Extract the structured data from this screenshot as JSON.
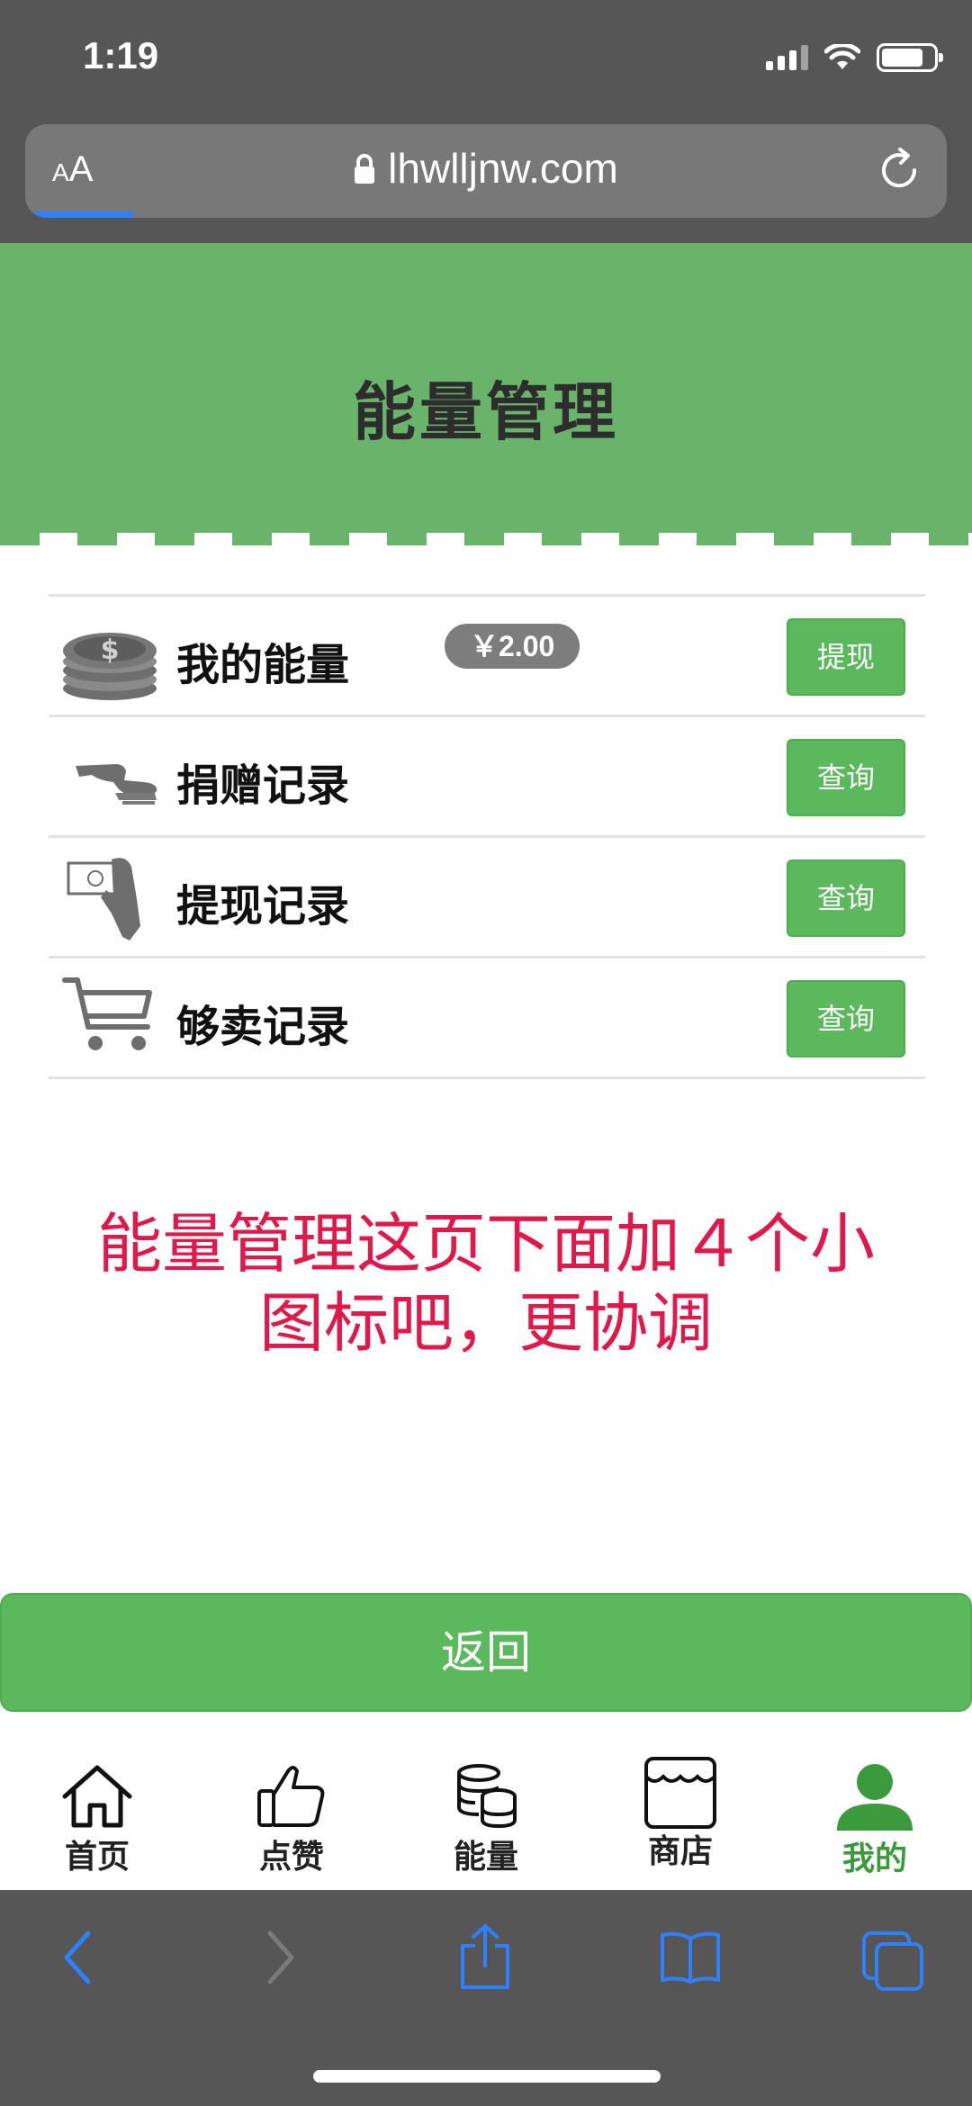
{
  "status_bar": {
    "time": "1:19",
    "battery_level": 0.8
  },
  "browser": {
    "text_size_label_small": "A",
    "text_size_label_large": "A",
    "url": "lhwlljnw.com",
    "load_progress": 0.11
  },
  "header": {
    "title": "能量管理",
    "color": "#69b46a"
  },
  "rows": [
    {
      "icon": "coins-icon",
      "label": "我的能量",
      "badge": "￥2.00",
      "button": "提现"
    },
    {
      "icon": "donate-hand-icon",
      "label": "捐赠记录",
      "button": "查询"
    },
    {
      "icon": "cash-hand-icon",
      "label": "提现记录",
      "button": "查询"
    },
    {
      "icon": "cart-icon",
      "label": "够卖记录",
      "button": "查询"
    }
  ],
  "annotation": {
    "line1": "能量管理这页下面加４个小",
    "line2": "图标吧，更协调",
    "color": "#e0194a"
  },
  "back_button": "返回",
  "tabbar": {
    "items": [
      {
        "icon": "home-icon",
        "label": "首页"
      },
      {
        "icon": "thumbs-up-icon",
        "label": "点赞"
      },
      {
        "icon": "database-icon",
        "label": "能量"
      },
      {
        "icon": "store-icon",
        "label": "商店"
      },
      {
        "icon": "user-icon",
        "label": "我的"
      }
    ],
    "active": "我的",
    "active_color": "#3a9a3c"
  },
  "safari_toolbar": {
    "items": [
      "back-icon",
      "forward-icon",
      "share-icon",
      "bookmarks-icon",
      "tabs-icon"
    ],
    "accent": "#2f80ff"
  }
}
